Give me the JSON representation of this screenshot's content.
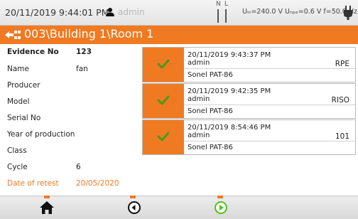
{
  "status": {
    "datetime": "20/11/2019 9:44:01 PM",
    "user": "admin",
    "phase_n": "N",
    "phase_l": "L",
    "voltage": "Uₗₙ=240.0 V Uₙₚₑ=0.6 V f=50.0 Hz",
    "icons": [
      "user-icon",
      "plug-icon"
    ]
  },
  "title": "003\\Building 1\\Room 1",
  "fields": [
    {
      "label": "Evidence No",
      "value": "123"
    },
    {
      "label": "Name",
      "value": "fan"
    },
    {
      "label": "Producer",
      "value": ""
    },
    {
      "label": "Model",
      "value": ""
    },
    {
      "label": "Serial No",
      "value": ""
    },
    {
      "label": "Year of production",
      "value": ""
    },
    {
      "label": "Class",
      "value": ""
    },
    {
      "label": "Cycle",
      "value": "6"
    },
    {
      "label": "Date of retest",
      "value": "20/05/2020"
    }
  ],
  "results": [
    {
      "time": "20/11/2019 9:43:37 PM",
      "user": "admin",
      "device": "Sonel PAT-86",
      "type": "RPE",
      "status": "pass"
    },
    {
      "time": "20/11/2019 9:42:35 PM",
      "user": "admin",
      "device": "Sonel PAT-86",
      "type": "RISO",
      "status": "pass"
    },
    {
      "time": "20/11/2019 8:54:46 PM",
      "user": "admin",
      "device": "Sonel PAT-86",
      "type": "101",
      "status": "pass"
    }
  ],
  "nav": {
    "buttons": [
      "home-icon",
      "back-icon",
      "play-icon"
    ]
  },
  "colors": {
    "accent": "#f07a22",
    "check": "#4a9a1e",
    "play": "#4fc21a"
  }
}
